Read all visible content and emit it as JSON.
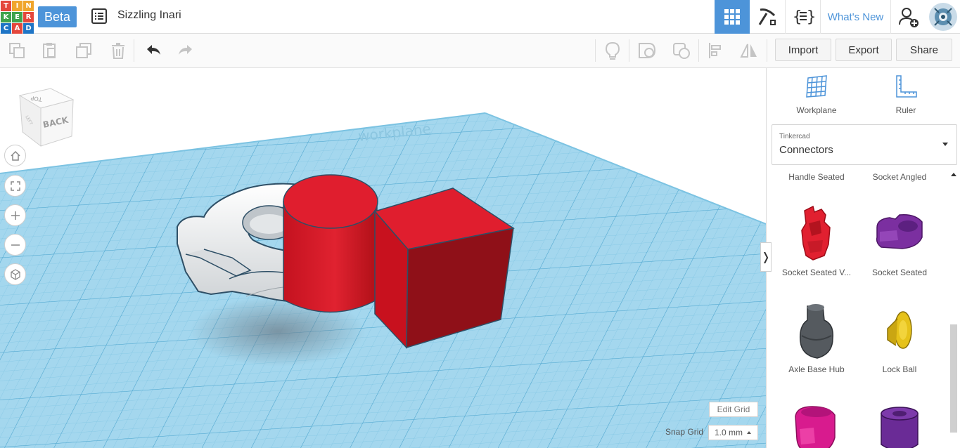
{
  "app": {
    "logo_letters": [
      "TIN",
      "KER",
      "CAD"
    ],
    "beta_label": "Beta",
    "design_title": "Sizzling Inari"
  },
  "header": {
    "whats_new": "What's New",
    "icons": [
      "3d-design-grid-icon",
      "pickaxe-icon",
      "code-blocks-icon",
      "add-user-icon",
      "avatar"
    ]
  },
  "toolbar": {
    "import_label": "Import",
    "export_label": "Export",
    "share_label": "Share"
  },
  "viewcube": {
    "top_label": "TOP",
    "back_label": "BACK",
    "side_label": "LEFT"
  },
  "workspace": {
    "watermark": "workplane",
    "edit_grid_label": "Edit Grid",
    "snap_grid_label": "Snap Grid",
    "snap_grid_value": "1.0 mm"
  },
  "sidebar": {
    "workplane_label": "Workplane",
    "ruler_label": "Ruler",
    "library_provider": "Tinkercad",
    "library_name": "Connectors",
    "shapes": [
      {
        "name": "Handle Seated",
        "color": "#888888"
      },
      {
        "name": "Socket Angled",
        "color": "#888888"
      },
      {
        "name": "Socket Seated V...",
        "color": "#e12030"
      },
      {
        "name": "Socket Seated",
        "color": "#7b2fa0"
      },
      {
        "name": "Axle Base Hub",
        "color": "#555a5f"
      },
      {
        "name": "Lock Ball",
        "color": "#e6c21a"
      },
      {
        "name": "",
        "color": "#d81b8e"
      },
      {
        "name": "",
        "color": "#6a2b96"
      }
    ]
  },
  "colors": {
    "accent": "#4d94d9",
    "grid_fill": "#9fd3eb",
    "grid_line": "#6fb8da",
    "shape_red": "#e01e2e"
  }
}
